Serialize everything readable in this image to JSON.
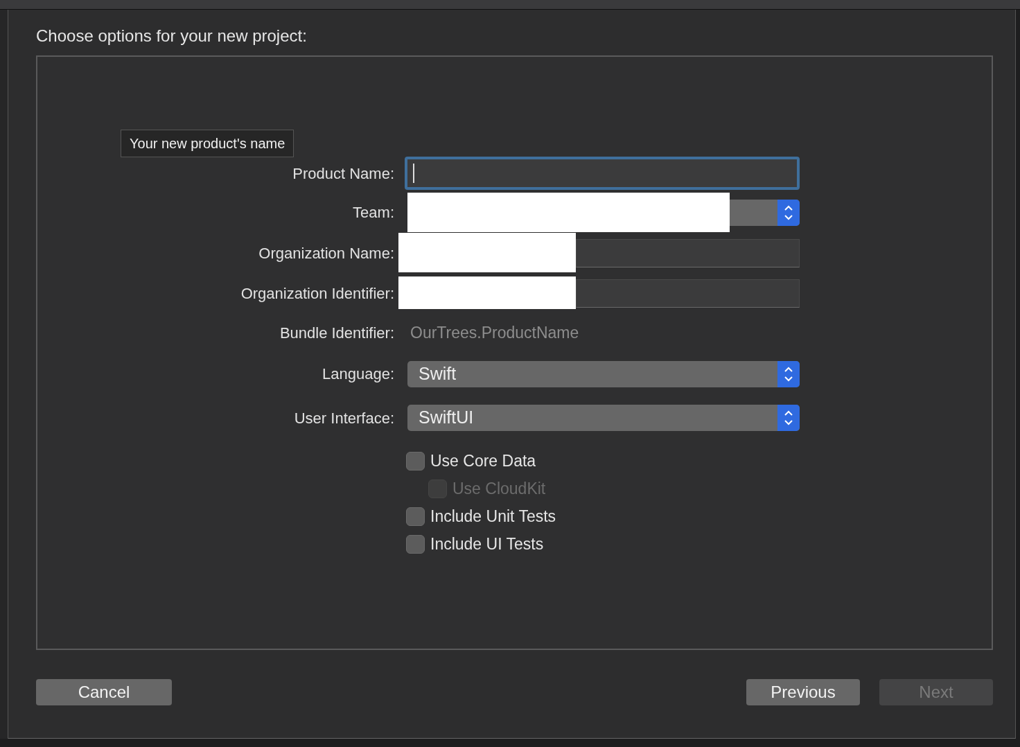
{
  "dialog": {
    "title": "Choose options for your new project:"
  },
  "tooltip": {
    "text": "Your new product's name"
  },
  "fields": [
    {
      "label": "Product Name:",
      "kind": "text",
      "focused": true
    },
    {
      "label": "Team:",
      "kind": "popup",
      "redacted": true
    },
    {
      "label": "Organization Name:",
      "kind": "text",
      "focused": false,
      "redacted": true
    },
    {
      "label": "Organization Identifier:",
      "kind": "text",
      "focused": false,
      "redacted": true
    },
    {
      "label": "Bundle Identifier:",
      "kind": "static",
      "value": "OurTrees.ProductName"
    },
    {
      "label": "Language:",
      "kind": "popup",
      "value": "Swift"
    },
    {
      "label": "User Interface:",
      "kind": "popup",
      "value": "SwiftUI"
    }
  ],
  "options": [
    {
      "label": "Use Core Data",
      "checked": false,
      "disabled": false,
      "children": [
        {
          "label": "Use CloudKit",
          "checked": false,
          "disabled": true
        }
      ]
    },
    {
      "label": "Include Unit Tests",
      "checked": false,
      "disabled": false
    },
    {
      "label": "Include UI Tests",
      "checked": false,
      "disabled": false
    }
  ],
  "buttons": [
    {
      "label": "Cancel",
      "disabled": false
    },
    {
      "label": "Previous",
      "disabled": false
    },
    {
      "label": "Next",
      "disabled": true
    }
  ]
}
